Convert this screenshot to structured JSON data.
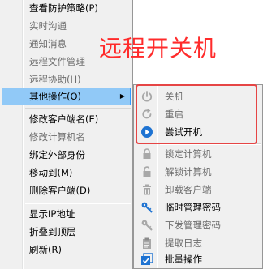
{
  "annotation": {
    "title": "远程开关机"
  },
  "main_menu": {
    "items": [
      {
        "label": "查看防护策略(P)",
        "disabled": false
      },
      {
        "label": "实时沟通",
        "disabled": true
      },
      {
        "label": "通知消息",
        "disabled": true
      },
      {
        "label": "远程文件管理",
        "disabled": true
      },
      {
        "label": "远程协助(H)",
        "disabled": true
      },
      {
        "label": "其他操作(O)",
        "disabled": false,
        "submenu_arrow": "▶"
      },
      {
        "label": "修改客户端名(E)",
        "disabled": false
      },
      {
        "label": "修改计算机名",
        "disabled": true
      },
      {
        "label": "绑定外部身份",
        "disabled": false
      },
      {
        "label": "移动到(M)",
        "disabled": false
      },
      {
        "label": "删除客户端(D)",
        "disabled": false
      },
      {
        "label": "显示IP地址",
        "disabled": false
      },
      {
        "label": "折叠到顶层",
        "disabled": false
      },
      {
        "label": "刷新(R)",
        "disabled": false
      }
    ]
  },
  "sub_menu": {
    "items": [
      {
        "label": "关机",
        "disabled": true,
        "icon": "power-icon"
      },
      {
        "label": "重启",
        "disabled": true,
        "icon": "restart-icon"
      },
      {
        "label": "尝试开机",
        "disabled": false,
        "icon": "play-icon"
      },
      {
        "label": "锁定计算机",
        "disabled": true,
        "icon": "lock-icon"
      },
      {
        "label": "解锁计算机",
        "disabled": true,
        "icon": "unlock-icon"
      },
      {
        "label": "卸载客户端",
        "disabled": true,
        "icon": "trash-icon"
      },
      {
        "label": "临时管理密码",
        "disabled": false,
        "icon": "key-icon"
      },
      {
        "label": "下发管理密码",
        "disabled": true,
        "icon": "key-icon"
      },
      {
        "label": "提取日志",
        "disabled": true,
        "icon": "log-icon"
      },
      {
        "label": "批量操作",
        "disabled": false,
        "icon": "batch-check-icon"
      }
    ]
  },
  "colors": {
    "annotation": "#ff2b2b",
    "highlight_box": "#e64545",
    "menu_selection": "#91c9f7",
    "accent_icon": "#1e73d2"
  }
}
